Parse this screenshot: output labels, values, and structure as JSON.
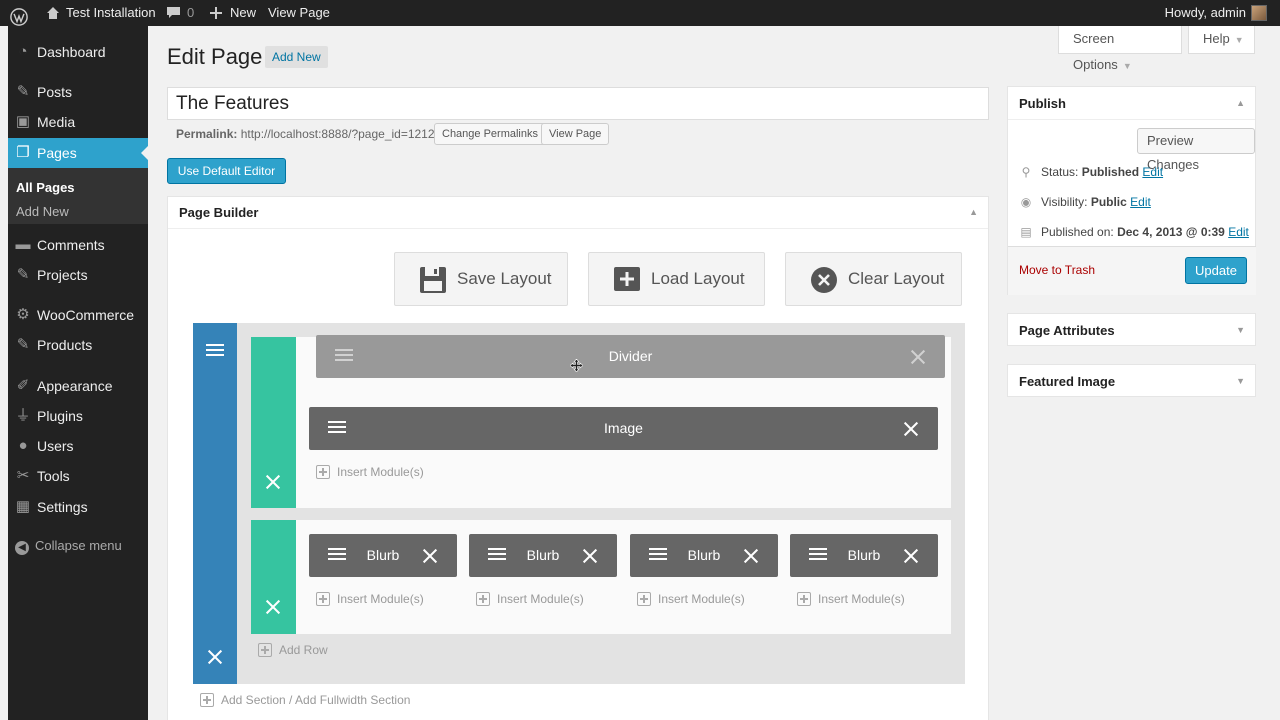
{
  "adminbar": {
    "site_name": "Test Installation",
    "comments_count": "0",
    "new_label": "New",
    "view_page_label": "View Page",
    "howdy": "Howdy, admin"
  },
  "sidebar": {
    "items": [
      {
        "label": "Dashboard",
        "icon": "dashboard-icon"
      },
      {
        "label": "Posts",
        "icon": "pin-icon"
      },
      {
        "label": "Media",
        "icon": "media-icon"
      },
      {
        "label": "Pages",
        "icon": "pages-icon"
      },
      {
        "label": "Comments",
        "icon": "comment-icon"
      },
      {
        "label": "Projects",
        "icon": "pin-icon"
      },
      {
        "label": "WooCommerce",
        "icon": "gear-icon"
      },
      {
        "label": "Products",
        "icon": "pin-icon"
      },
      {
        "label": "Appearance",
        "icon": "brush-icon"
      },
      {
        "label": "Plugins",
        "icon": "plug-icon"
      },
      {
        "label": "Users",
        "icon": "users-icon"
      },
      {
        "label": "Tools",
        "icon": "wrench-icon"
      },
      {
        "label": "Settings",
        "icon": "settings-icon"
      }
    ],
    "submenu": [
      "All Pages",
      "Add New"
    ],
    "collapse_label": "Collapse menu"
  },
  "header": {
    "screen_options": "Screen Options",
    "help": "Help",
    "title": "Edit Page",
    "add_new": "Add New"
  },
  "editor": {
    "post_title": "The Features",
    "permalink_label": "Permalink:",
    "permalink_url": "http://localhost:8888/?page_id=1212",
    "change_permalinks": "Change Permalinks",
    "view_page": "View Page",
    "default_editor_button": "Use Default Editor"
  },
  "builder": {
    "title": "Page Builder",
    "save_layout": "Save Layout",
    "load_layout": "Load Layout",
    "clear_layout": "Clear Layout",
    "row1_modules": [
      "Divider",
      "Image"
    ],
    "row2_modules": [
      "Blurb",
      "Blurb",
      "Blurb",
      "Blurb"
    ],
    "insert_modules": "Insert Module(s)",
    "add_row": "Add Row",
    "add_section": "Add Section / Add Fullwidth Section"
  },
  "publish": {
    "title": "Publish",
    "preview_changes": "Preview Changes",
    "status_label": "Status:",
    "status_value": "Published",
    "visibility_label": "Visibility:",
    "visibility_value": "Public",
    "published_on_label": "Published on:",
    "published_on_value": "Dec 4, 2013 @ 0:39",
    "edit": "Edit",
    "move_to_trash": "Move to Trash",
    "update": "Update"
  },
  "page_attributes": {
    "title": "Page Attributes"
  },
  "featured_image": {
    "title": "Featured Image"
  },
  "colors": {
    "accent": "#2ea2cc",
    "section_blue": "#3583b8",
    "row_green": "#36c4a0",
    "module_gray": "#666666"
  }
}
